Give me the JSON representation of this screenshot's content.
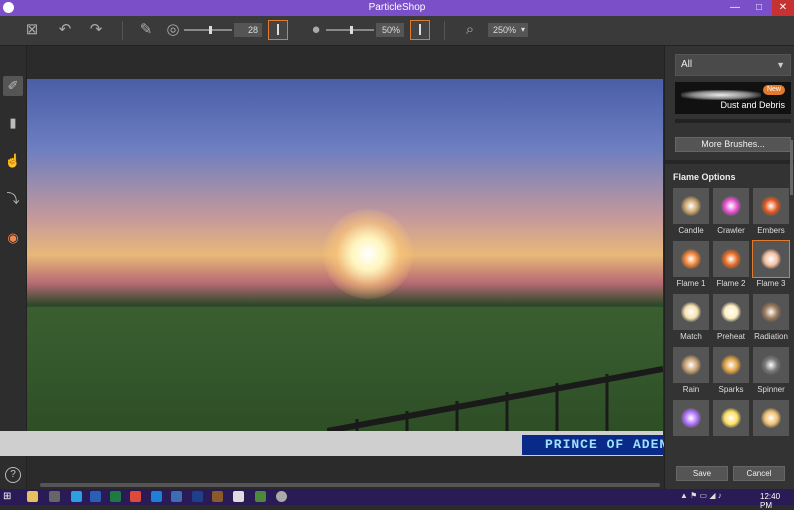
{
  "window": {
    "title": "ParticleShop",
    "minimize": "—",
    "maximize": "□",
    "close": "✕"
  },
  "toolbar": {
    "brush_size": "28",
    "opacity": "50%",
    "zoom": "250%",
    "zoom_arrow": "▾",
    "brush_size_fraction": 0.28,
    "opacity_fraction": 0.5
  },
  "left_tools": [
    "brush-icon",
    "eraser-icon",
    "smudge-icon",
    "eyedropper-icon",
    "color-wheel-icon"
  ],
  "right_panel": {
    "category": "All",
    "category_arrow": "▼",
    "brush_card": {
      "badge": "New",
      "label": "Dust and Debris"
    },
    "more_brushes": "More Brushes...",
    "section_title": "Flame Options",
    "brushes": [
      {
        "label": "Candle",
        "color": "#c9a46a"
      },
      {
        "label": "Crawler",
        "color": "#e84fd0"
      },
      {
        "label": "Embers",
        "color": "#e2571e"
      },
      {
        "label": "Flame 1",
        "color": "#f08030"
      },
      {
        "label": "Flame 2",
        "color": "#e86a20"
      },
      {
        "label": "Flame 3",
        "color": "#f5c0a0"
      },
      {
        "label": "Match",
        "color": "#f7e2b0"
      },
      {
        "label": "Preheat",
        "color": "#fff0c0"
      },
      {
        "label": "Radiation",
        "color": "#9c7a5a"
      },
      {
        "label": "Rain",
        "color": "#c8a070"
      },
      {
        "label": "Sparks",
        "color": "#e0a040"
      },
      {
        "label": "Spinner",
        "color": "#777777"
      },
      {
        "label": "",
        "color": "#b070ff"
      },
      {
        "label": "",
        "color": "#ffe060"
      },
      {
        "label": "",
        "color": "#f0c070"
      }
    ]
  },
  "bottom": {
    "help": "?",
    "save": "Save",
    "cancel": "Cancel"
  },
  "watermark": {
    "text": "PRINCE OF ADEN/ZYZOOM.NET"
  },
  "taskbar": {
    "clock": "12:40 PM"
  },
  "colors": {
    "accent": "#e07a2e",
    "titlebar": "#7a4fc7",
    "taskbar": "#2a1a55"
  }
}
